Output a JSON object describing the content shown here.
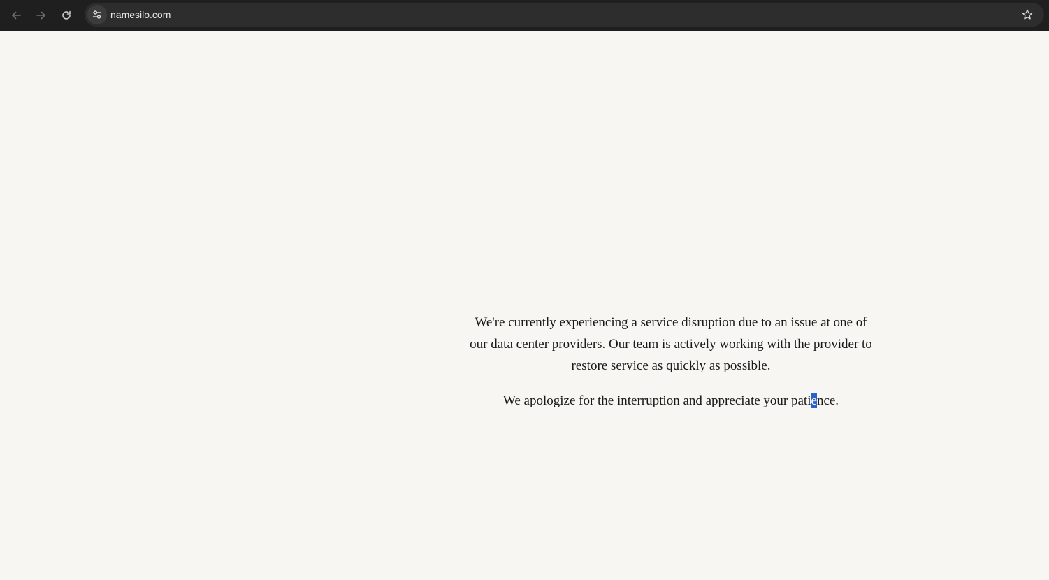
{
  "browser": {
    "url": "namesilo.com",
    "icons": {
      "back": "arrow-left-icon",
      "forward": "arrow-right-icon",
      "reload": "reload-icon",
      "site_info": "tune-icon",
      "bookmark": "star-icon"
    }
  },
  "page": {
    "paragraph1": "We're currently experiencing a service disruption due to an issue at one of our data center providers. Our team is actively working with the provider to restore service as quickly as possible.",
    "paragraph2_before": "We apologize for the interruption and appreciate your pati",
    "paragraph2_selected": "e",
    "paragraph2_after": "nce."
  },
  "colors": {
    "toolbar": "#1f1f1f",
    "omnibox": "#2d2d2d",
    "page_background": "#f7f6f2",
    "text": "#1a1a1a",
    "selection": "#2a62c9"
  }
}
